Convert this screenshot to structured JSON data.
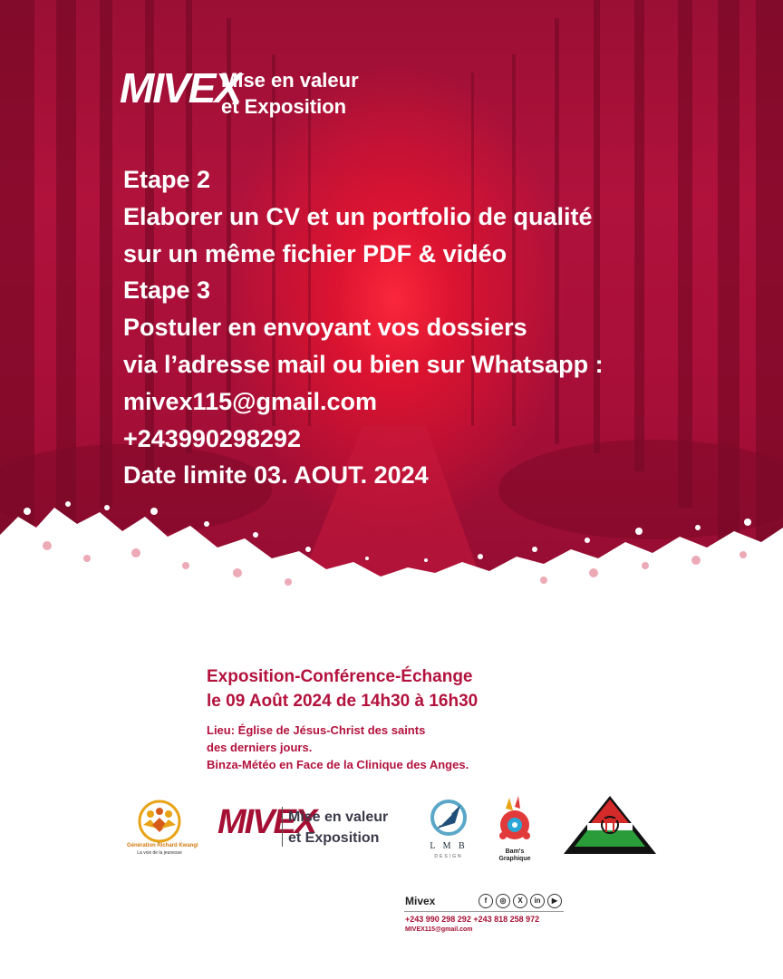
{
  "brand": {
    "logo_text": "MIVEX",
    "logo_name": "mivex-logo",
    "tagline_line1": "Mise en valeur",
    "tagline_line2": "et Exposition"
  },
  "steps": {
    "step2_title": "Etape 2",
    "step2_line1": "Elaborer un CV et un portfolio de qualité",
    "step2_line2": "sur un même fichier PDF & vidéo",
    "step3_title": "Etape 3",
    "step3_line1": "Postuler en envoyant vos dossiers",
    "step3_line2": "via l’adresse mail ou bien sur Whatsapp :",
    "email": "mivex115@gmail.com",
    "phone": "+243990298292",
    "deadline": "Date limite 03. AOUT. 2024"
  },
  "event": {
    "title": "Exposition-Conférence-Échange",
    "datetime": "le 09 Août 2024 de 14h30 à 16h30",
    "venue_line1": "Lieu: Église de Jésus-Christ des saints",
    "venue_line2": "des derniers jours.",
    "venue_line3": "Binza-Météo en Face de la Clinique des Anges."
  },
  "partners": {
    "generation": {
      "name": "Génération Richard Kwangi",
      "sub": "La voix de la jeunesse",
      "icon": "people-logo-icon"
    },
    "mivex": {
      "mark": "MIVEX",
      "line1": "Mise en valeur",
      "line2": "et Exposition"
    },
    "lmb": {
      "name": "L M B",
      "sub": "DESIGN",
      "icon": "rocket-logo-icon"
    },
    "bams": {
      "name_line1": "Bam's",
      "name_line2": "Graphique",
      "icon": "paint-logo-icon"
    },
    "pt": {
      "icon": "triangle-logo-icon"
    }
  },
  "footer": {
    "name": "Mivex",
    "phones": "+243 990 298 292 +243 818 258 972",
    "email": "MIVEX115@gmail.com",
    "socials": [
      {
        "icon": "facebook-icon",
        "glyph": "f"
      },
      {
        "icon": "instagram-icon",
        "glyph": "◎"
      },
      {
        "icon": "x-icon",
        "glyph": "X"
      },
      {
        "icon": "linkedin-icon",
        "glyph": "in"
      },
      {
        "icon": "youtube-icon",
        "glyph": "▶"
      }
    ]
  },
  "colors": {
    "primary_red": "#b3123d",
    "dark_red": "#8e0c30",
    "glow_red": "#ff283c",
    "text_dark": "#3a3a4a"
  }
}
